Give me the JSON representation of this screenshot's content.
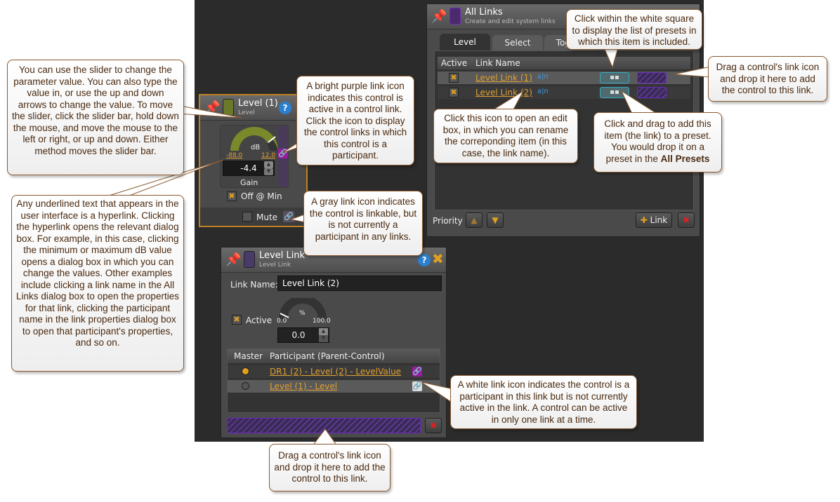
{
  "level_panel": {
    "title": "Level (1)",
    "subtitle": "Level",
    "unit": "dB",
    "min": "-88.0",
    "max": "12.0",
    "value": "-4.4",
    "gain_label": "Gain",
    "off_at_min": "Off @ Min",
    "mute": "Mute",
    "swatch_color": "#6b7a2a",
    "link_icon": "link-icon-purple"
  },
  "all_links": {
    "title": "All Links",
    "subtitle": "Create and edit system links",
    "tabs": [
      "Level",
      "Select",
      "Toggle"
    ],
    "columns": [
      "Active",
      "Link Name"
    ],
    "rows": [
      {
        "name": "Level Link (1)",
        "active": true
      },
      {
        "name": "Level Link (2)",
        "active": true
      }
    ],
    "edit_icon": "a|n",
    "priority": "Priority",
    "add_link": "Link",
    "swatch_color": "#4a2a6a"
  },
  "level_link": {
    "title": "Level Link",
    "subtitle": "Level Link",
    "link_name_label": "Link Name:",
    "link_name_value": "Level Link (2)",
    "active_label": "Active",
    "unit": "%",
    "min": "0.0",
    "max": "100.0",
    "value": "0.0",
    "columns": [
      "Master",
      "Participant (Parent-Control)"
    ],
    "rows": [
      {
        "name": "DR1 (2) - Level (2) - LevelValue",
        "master": true,
        "icon": "link-icon-purple"
      },
      {
        "name": "Level (1) - Level",
        "master": false,
        "icon": "link-icon-white"
      }
    ]
  },
  "callouts": {
    "slider": "You can use the slider to change the parameter value. You can also type the value in, or use the up and down arrows to change the value. To move the slider, click the slider bar, hold down the mouse, and move the mouse to the left or right, or up and down. Either method moves the slider bar.",
    "hyperlink": "Any underlined text that appears in the user interface is a hyperlink. Clicking the hyperlink opens the relevant dialog box. For example, in this case, clicking the minimum or maximum dB value opens a dialog box in which you can change the values. Other examples include clicking a link name in the All Links dialog box to open the properties for that link, clicking the participant name in the link properties dialog box to open that participant's properties, and so on.",
    "purple_icon": "A bright purple link icon indicates this control is active in a control link. Click the icon to display the control links in which this control is a participant.",
    "gray_icon": "A gray link icon indicates the control is linkable, but is not currently a participant in any links.",
    "white_square": "Click within the white square to display the list of presets in which this item is included.",
    "drag_top": "Drag a control's link icon and drop it here to add the control to this link.",
    "edit_icon": "Click this icon to open an edit box, in which you can rename the correponding item (in this case, the link name).",
    "preset_pre": "Click and drag to add this item (the link) to a preset. You would drop it on a preset in the ",
    "preset_bold": "All Presets",
    "white_icon": "A white link icon indicates the control is a participant in this link but is not currently active in the link. A control can be active in only one link at a time.",
    "drag_bottom": "Drag a control's link icon and drop it here to add the control to this link."
  }
}
